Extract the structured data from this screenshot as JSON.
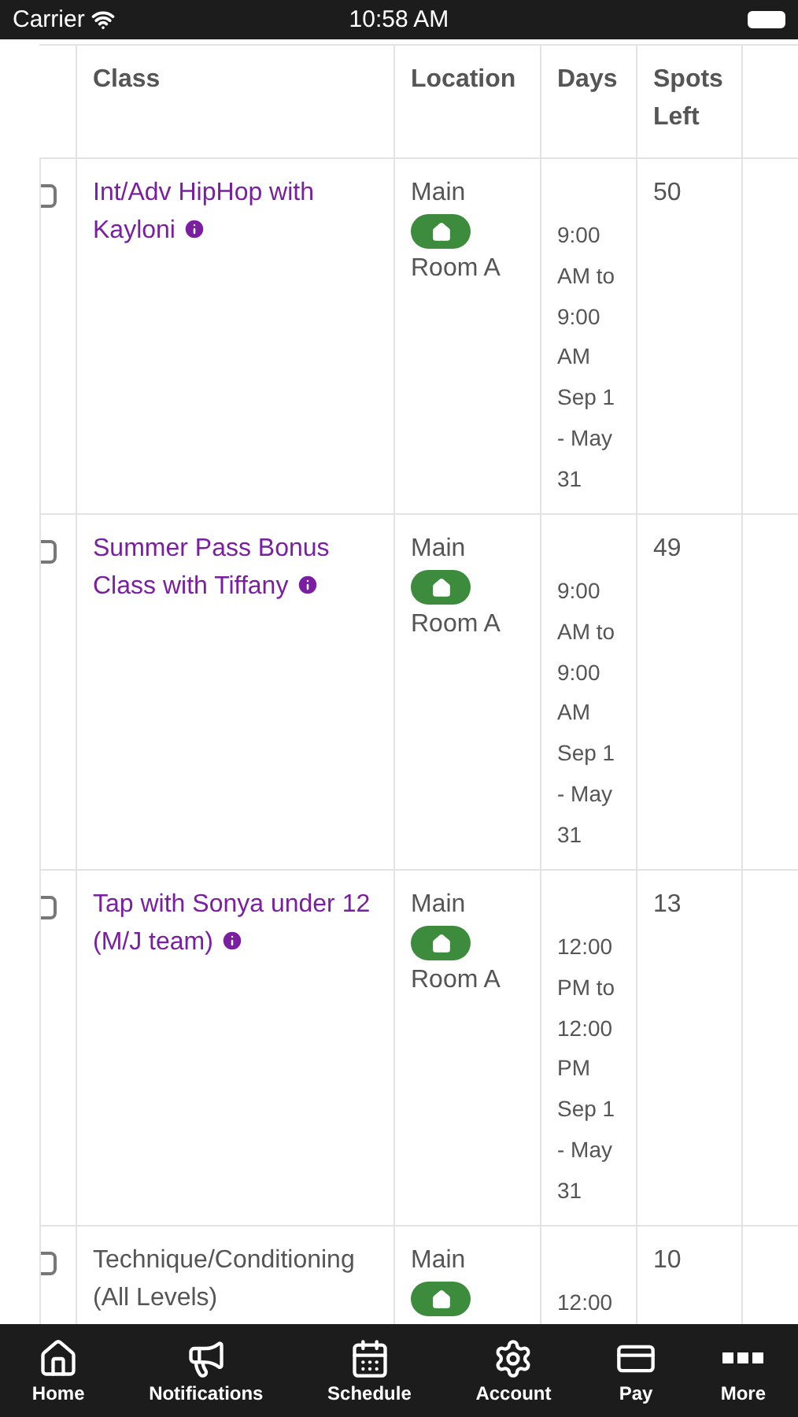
{
  "status_bar": {
    "carrier": "Carrier",
    "time": "10:58 AM"
  },
  "table": {
    "columns": [
      "Class",
      "Location",
      "Days",
      "Spots Left"
    ],
    "rows": [
      {
        "checked": false,
        "class": "Int/Adv HipHop with Kayloni",
        "link": true,
        "location": "Main",
        "room": "Room A",
        "days": [
          "9:00",
          "AM to",
          "9:00",
          "AM",
          "Sep 1",
          "- May",
          "31"
        ],
        "spots": "50"
      },
      {
        "checked": false,
        "class": "Summer Pass Bonus Class with Tiffany",
        "link": true,
        "location": "Main",
        "room": "Room A",
        "days": [
          "9:00",
          "AM to",
          "9:00",
          "AM",
          "Sep 1",
          "- May",
          "31"
        ],
        "spots": "49"
      },
      {
        "checked": false,
        "class": "Tap with Sonya under 12 (M/J team)",
        "link": true,
        "location": "Main",
        "room": "Room A",
        "days": [
          "12:00",
          "PM to",
          "12:00",
          "PM",
          "Sep 1",
          "- May",
          "31"
        ],
        "spots": "13"
      },
      {
        "checked": false,
        "class": "Technique/Conditioning (All Levels)",
        "link": false,
        "location": "Main",
        "days": [
          "12:00"
        ],
        "spots": "10"
      }
    ]
  },
  "tab_bar": [
    {
      "label": "Home"
    },
    {
      "label": "Notifications"
    },
    {
      "label": "Schedule"
    },
    {
      "label": "Account"
    },
    {
      "label": "Pay"
    },
    {
      "label": "More"
    }
  ]
}
